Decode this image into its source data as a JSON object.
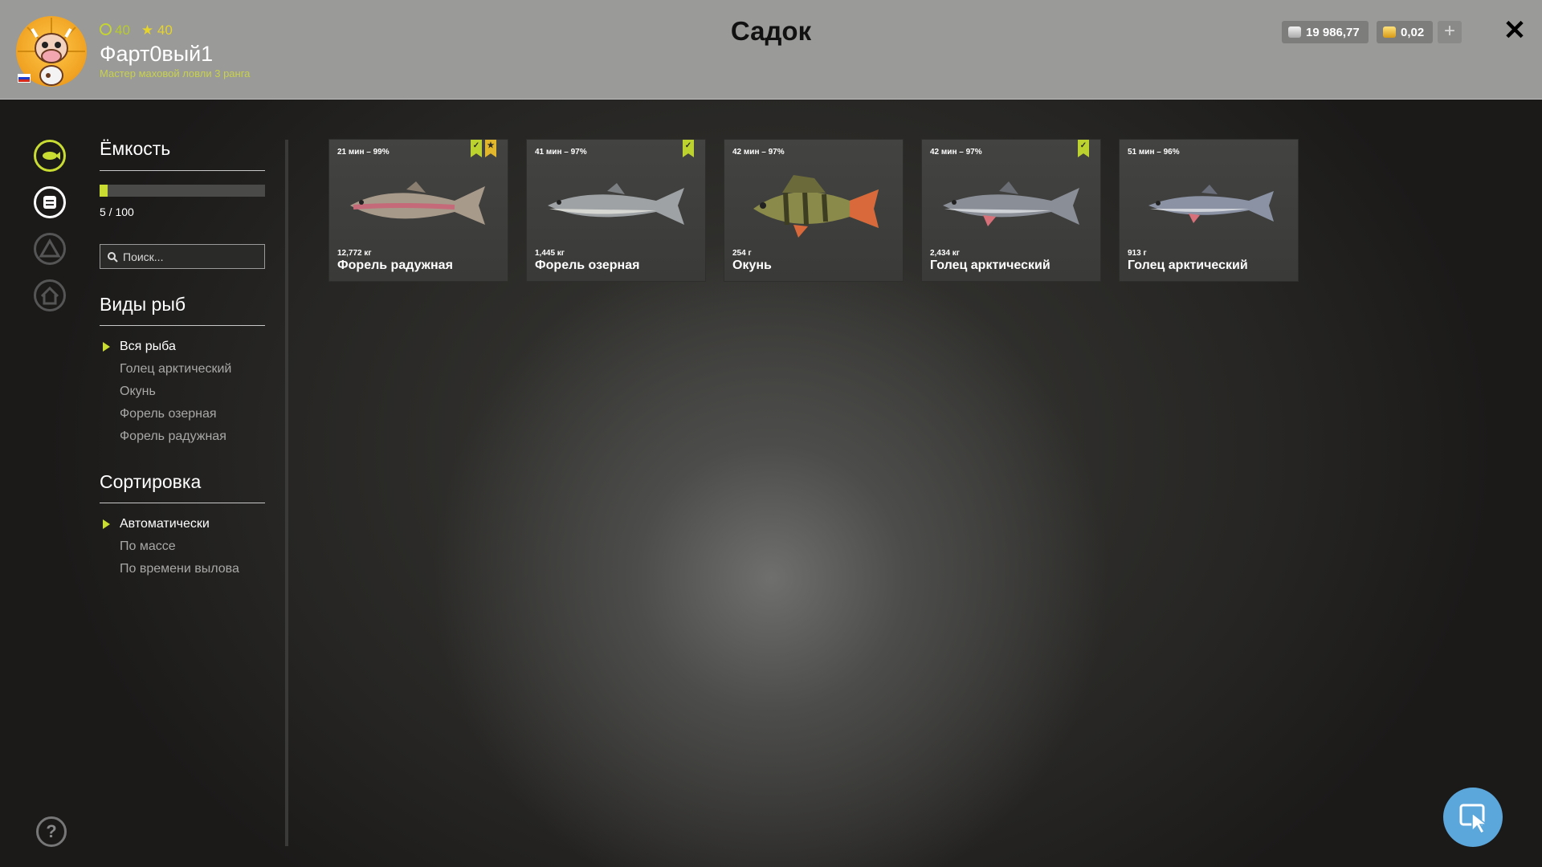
{
  "header": {
    "title": "Садок",
    "player": {
      "level": "40",
      "stars": "40",
      "name": "Фарт0вый1",
      "rank": "Мастер маховой ловли 3 ранга"
    },
    "silver": "19 986,77",
    "gold": "0,02",
    "add_label": "+",
    "close_label": "✕"
  },
  "sidebar": {
    "capacity_title": "Ёмкость",
    "capacity_text": "5 / 100",
    "capacity_fraction": 0.05,
    "search_placeholder": "Поиск...",
    "species_title": "Виды рыб",
    "species": [
      "Вся рыба",
      "Голец арктический",
      "Окунь",
      "Форель озерная",
      "Форель радужная"
    ],
    "sort_title": "Сортировка",
    "sort": [
      "Автоматически",
      "По массе",
      "По времени вылова"
    ],
    "help_label": "?"
  },
  "cards": [
    {
      "meta": "21 мин – 99%",
      "weight": "12,772 кг",
      "name": "Форель радужная",
      "badges": [
        "check",
        "star"
      ]
    },
    {
      "meta": "41 мин – 97%",
      "weight": "1,445 кг",
      "name": "Форель озерная",
      "badges": [
        "check"
      ]
    },
    {
      "meta": "42 мин – 97%",
      "weight": "254 г",
      "name": "Окунь",
      "badges": []
    },
    {
      "meta": "42 мин – 97%",
      "weight": "2,434 кг",
      "name": "Голец арктический",
      "badges": [
        "check"
      ]
    },
    {
      "meta": "51 мин – 96%",
      "weight": "913 г",
      "name": "Голец арктический",
      "badges": []
    }
  ],
  "colors": {
    "accent": "#c8dc32",
    "fab": "#5ba7dc"
  }
}
